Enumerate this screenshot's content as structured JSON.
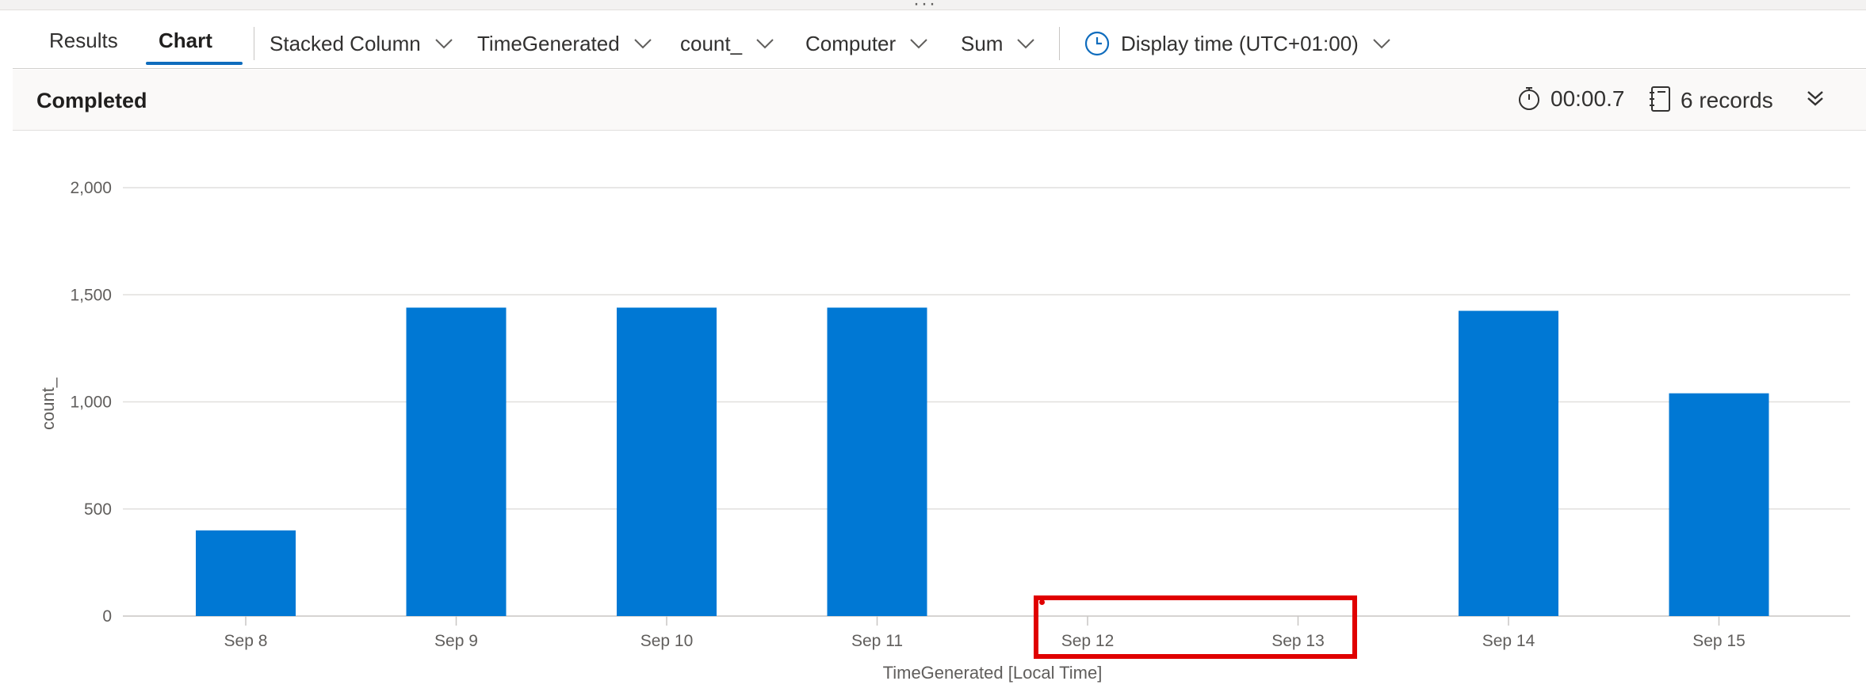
{
  "tabs": [
    {
      "label": "Results",
      "active": false
    },
    {
      "label": "Chart",
      "active": true
    }
  ],
  "toolbar": {
    "chart_type": "Stacked Column",
    "x_column": "TimeGenerated",
    "y_column": "count_",
    "split_by": "Computer",
    "aggregation": "Sum",
    "display_time": "Display time (UTC+01:00)"
  },
  "status": {
    "state": "Completed",
    "duration": "00:00.7",
    "records": "6 records"
  },
  "icons": {
    "chevron": "chevron-down-icon",
    "clock": "clock-icon",
    "timer": "stopwatch-icon",
    "records": "notebook-icon",
    "expand": "double-chevron-down-icon"
  },
  "colors": {
    "bar": "#0078d4",
    "accent": "#0f6cbd",
    "highlight": "#e00000"
  },
  "chart_data": {
    "type": "bar",
    "stacked": true,
    "categories": [
      "Sep 8",
      "Sep 9",
      "Sep 10",
      "Sep 11",
      "Sep 12",
      "Sep 13",
      "Sep 14",
      "Sep 15"
    ],
    "values": [
      400,
      1440,
      1440,
      1440,
      null,
      null,
      1425,
      1040
    ],
    "xlabel": "TimeGenerated [Local Time]",
    "ylabel": "count_",
    "ylim": [
      0,
      2000
    ],
    "yticks": [
      0,
      500,
      1000,
      1500,
      2000
    ],
    "ytick_labels": [
      "0",
      "500",
      "1,000",
      "1,500",
      "2,000"
    ],
    "grid": true,
    "legend": "none"
  }
}
